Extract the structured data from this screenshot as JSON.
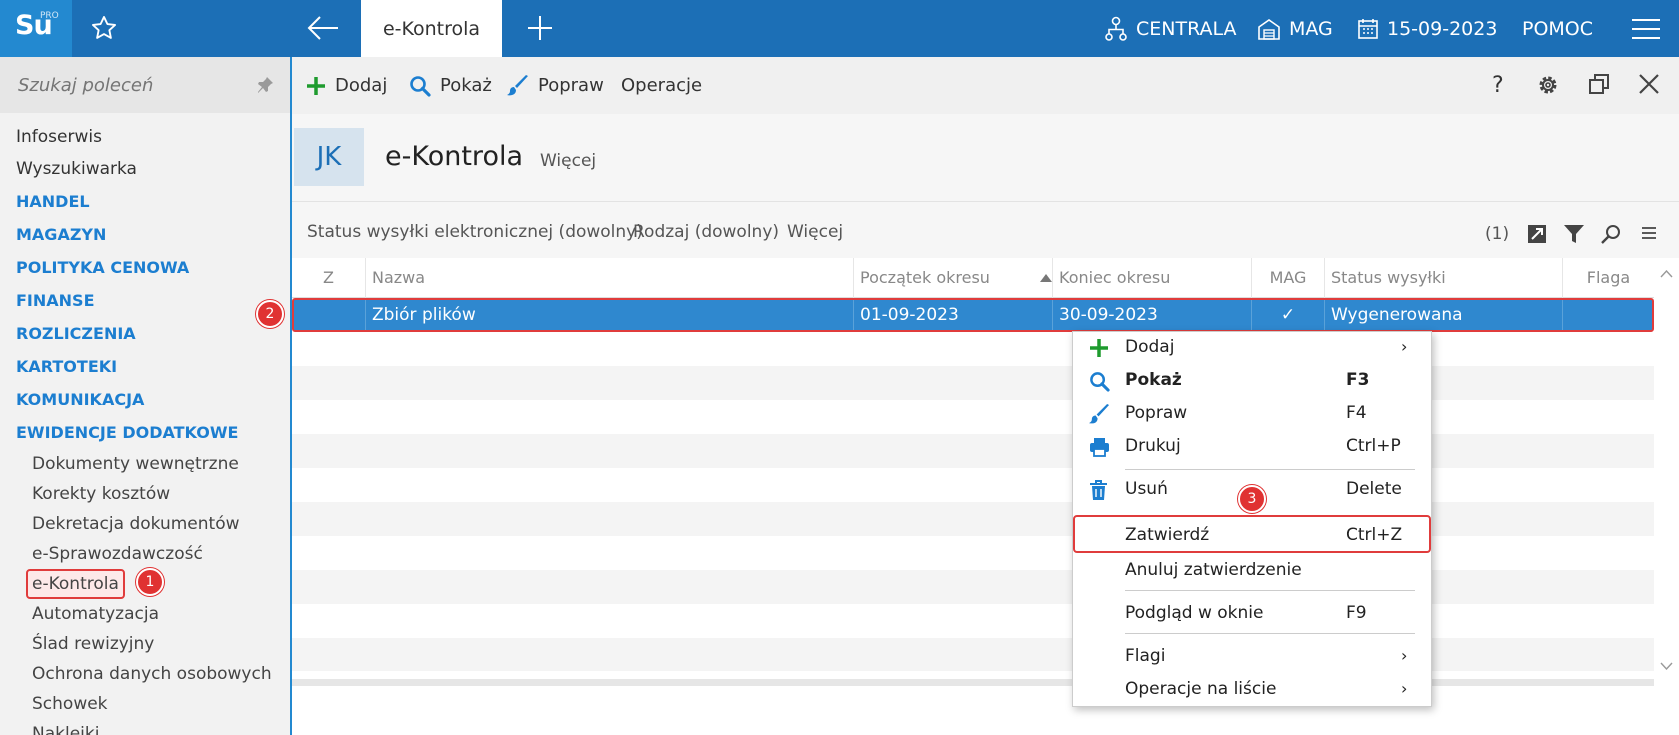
{
  "topbar": {
    "logo": "Su",
    "logo_badge": "PRO",
    "active_tab": "e-Kontrola",
    "centrala": "CENTRALA",
    "mag": "MAG",
    "date": "15-09-2023",
    "help": "POMOC",
    "colors": {
      "bar": "#1c6fb6",
      "logo_bg": "#2389d0"
    }
  },
  "sidebar": {
    "search_placeholder": "Szukaj poleceń",
    "items": [
      {
        "label": "Infoserwis",
        "kind": "link"
      },
      {
        "label": "Wyszukiwarka",
        "kind": "link"
      },
      {
        "label": "HANDEL",
        "kind": "category"
      },
      {
        "label": "MAGAZYN",
        "kind": "category"
      },
      {
        "label": "POLITYKA CENOWA",
        "kind": "category"
      },
      {
        "label": "FINANSE",
        "kind": "category"
      },
      {
        "label": "ROZLICZENIA",
        "kind": "category"
      },
      {
        "label": "KARTOTEKI",
        "kind": "category"
      },
      {
        "label": "KOMUNIKACJA",
        "kind": "category"
      },
      {
        "label": "EWIDENCJE DODATKOWE",
        "kind": "category"
      }
    ],
    "subitems": [
      "Dokumenty wewnętrzne",
      "Korekty kosztów",
      "Dekretacja dokumentów",
      "e-Sprawozdawczość",
      "e-Kontrola",
      "Automatyzacja",
      "Ślad rewizyjny",
      "Ochrona danych osobowych",
      "Schowek",
      "Naklejki"
    ],
    "active_subitem": "e-Kontrola"
  },
  "toolbar": {
    "add": "Dodaj",
    "show": "Pokaż",
    "edit": "Popraw",
    "operations": "Operacje",
    "help": "?"
  },
  "header": {
    "badge": "JK",
    "title": "e-Kontrola",
    "more": "Więcej"
  },
  "filters": {
    "status": "Status wysyłki elektronicznej (dowolny)",
    "type": "Rodzaj (dowolny)",
    "more": "Więcej",
    "count": "(1)"
  },
  "grid": {
    "columns": [
      "Z",
      "Nazwa",
      "Początek okresu",
      "Koniec okresu",
      "MAG",
      "Status wysyłki",
      "Flaga"
    ],
    "rows": [
      {
        "z": "",
        "name": "Zbiór plików",
        "start": "01-09-2023",
        "end": "30-09-2023",
        "mag": "✓",
        "status": "Wygenerowana",
        "flag": ""
      }
    ],
    "selected_color": "#2f88cf"
  },
  "context_menu": {
    "items": [
      {
        "label": "Dodaj",
        "shortcut": "",
        "submenu": "›",
        "icon": "plus-icon"
      },
      {
        "label": "Pokaż",
        "shortcut": "F3",
        "submenu": "",
        "icon": "search-icon"
      },
      {
        "label": "Popraw",
        "shortcut": "F4",
        "submenu": "",
        "icon": "brush-icon"
      },
      {
        "label": "Drukuj",
        "shortcut": "Ctrl+P",
        "submenu": "",
        "icon": "printer-icon"
      },
      {
        "label": "Usuń",
        "shortcut": "Delete",
        "submenu": "",
        "icon": "trash-icon"
      },
      {
        "label": "Zatwierdź",
        "shortcut": "Ctrl+Z",
        "submenu": "",
        "icon": ""
      },
      {
        "label": "Anuluj zatwierdzenie",
        "shortcut": "",
        "submenu": "",
        "icon": ""
      },
      {
        "label": "Podgląd w oknie",
        "shortcut": "F9",
        "submenu": "",
        "icon": ""
      },
      {
        "label": "Flagi",
        "shortcut": "",
        "submenu": "›",
        "icon": ""
      },
      {
        "label": "Operacje na liście",
        "shortcut": "",
        "submenu": "›",
        "icon": ""
      }
    ]
  },
  "markers": [
    "1",
    "2",
    "3"
  ]
}
